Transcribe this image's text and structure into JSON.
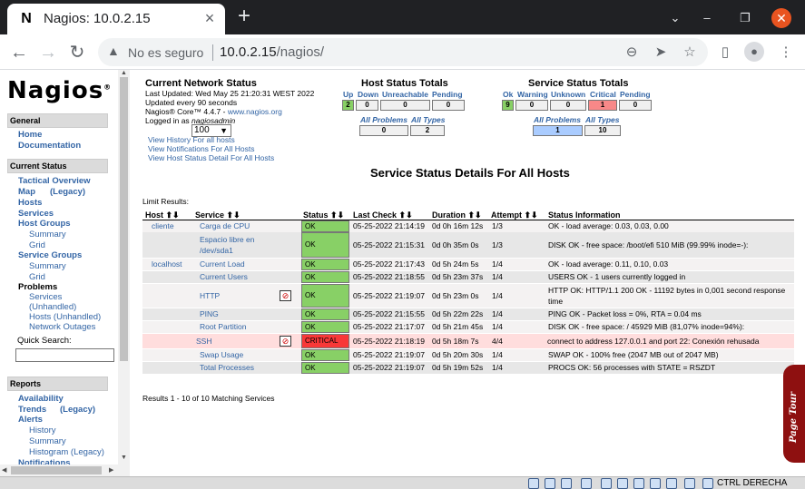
{
  "browser": {
    "tab_title": "Nagios: 10.0.2.15",
    "favicon": "N",
    "new_tab": "+",
    "not_secure": "No es seguro",
    "url_host": "10.0.2.15",
    "url_path": "/nagios/"
  },
  "sidebar": {
    "logo": "Nagios",
    "sections": {
      "general": "General",
      "current_status": "Current Status",
      "reports": "Reports"
    },
    "general_links": [
      "Home",
      "Documentation"
    ],
    "status_links": {
      "tactical": "Tactical Overview",
      "map": "Map",
      "legacy": "(Legacy)",
      "hosts": "Hosts",
      "services": "Services",
      "host_groups": "Host Groups",
      "hg_summary": "Summary",
      "hg_grid": "Grid",
      "service_groups": "Service Groups",
      "sg_summary": "Summary",
      "sg_grid": "Grid",
      "problems": "Problems",
      "p_services": "Services",
      "p_unhandled_1": "(Unhandled)",
      "p_hosts": "Hosts (Unhandled)",
      "p_network": "Network Outages"
    },
    "quick_search": "Quick Search:",
    "report_links": {
      "availability": "Availability",
      "trends": "Trends",
      "trends_legacy": "(Legacy)",
      "alerts": "Alerts",
      "history": "History",
      "summary": "Summary",
      "histogram": "Histogram (Legacy)",
      "notifications": "Notifications"
    }
  },
  "network_status": {
    "title": "Current Network Status",
    "last_updated": "Last Updated: Wed May 25 21:20:31 WEST 2022",
    "updated_every": "Updated every 90 seconds",
    "version_prefix": "Nagios® Core™ 4.4.7 - ",
    "version_link": "www.nagios.org",
    "logged_in_prefix": "Logged in as ",
    "logged_in_user": "nagiosadmin",
    "links": [
      "View History For all hosts",
      "View Notifications For All Hosts",
      "View Host Status Detail For All Hosts"
    ]
  },
  "host_totals": {
    "title": "Host Status Totals",
    "headers": [
      "Up",
      "Down",
      "Unreachable",
      "Pending"
    ],
    "values": [
      "2",
      "0",
      "0",
      "0"
    ],
    "all_headers": [
      "All Problems",
      "All Types"
    ],
    "all_values": [
      "0",
      "2"
    ]
  },
  "service_totals": {
    "title": "Service Status Totals",
    "headers": [
      "Ok",
      "Warning",
      "Unknown",
      "Critical",
      "Pending"
    ],
    "values": [
      "9",
      "0",
      "0",
      "1",
      "0"
    ],
    "all_headers": [
      "All Problems",
      "All Types"
    ],
    "all_values": [
      "1",
      "10"
    ]
  },
  "details": {
    "title": "Service Status Details For All Hosts",
    "limit_label": "Limit Results:",
    "limit_value": "100",
    "columns": [
      "Host",
      "Service",
      "Status",
      "Last Check",
      "Duration",
      "Attempt",
      "Status Information"
    ],
    "results": "Results 1 - 10 of 10 Matching Services",
    "rows": [
      {
        "host": "cliente",
        "service": "Carga de CPU",
        "status": "OK",
        "last": "05-25-2022 21:14:19",
        "duration": "0d 0h 16m 12s",
        "attempt": "1/3",
        "info": "OK - load average: 0.03, 0.03, 0.00"
      },
      {
        "host": "",
        "service": "Espacio libre en /dev/sda1",
        "status": "OK",
        "last": "05-25-2022 21:15:31",
        "duration": "0d 0h 35m 0s",
        "attempt": "1/3",
        "info": "DISK OK - free space: /boot/efi 510 MiB (99.99% inode=-):"
      },
      {
        "host": "localhost",
        "service": "Current Load",
        "status": "OK",
        "last": "05-25-2022 21:17:43",
        "duration": "0d 5h 24m 5s",
        "attempt": "1/4",
        "info": "OK - load average: 0.11, 0.10, 0.03"
      },
      {
        "host": "",
        "service": "Current Users",
        "status": "OK",
        "last": "05-25-2022 21:18:55",
        "duration": "0d 5h 23m 37s",
        "attempt": "1/4",
        "info": "USERS OK - 1 users currently logged in"
      },
      {
        "host": "",
        "service": "HTTP",
        "status": "OK",
        "last": "05-25-2022 21:19:07",
        "duration": "0d 5h 23m 0s",
        "attempt": "1/4",
        "info": "HTTP OK: HTTP/1.1 200 OK - 11192 bytes in 0,001 second response time"
      },
      {
        "host": "",
        "service": "PING",
        "status": "OK",
        "last": "05-25-2022 21:15:55",
        "duration": "0d 5h 22m 22s",
        "attempt": "1/4",
        "info": "PING OK - Packet loss = 0%, RTA = 0.04 ms"
      },
      {
        "host": "",
        "service": "Root Partition",
        "status": "OK",
        "last": "05-25-2022 21:17:07",
        "duration": "0d 5h 21m 45s",
        "attempt": "1/4",
        "info": "DISK OK - free space: / 45929 MiB (81,07% inode=94%):"
      },
      {
        "host": "",
        "service": "SSH",
        "status": "CRITICAL",
        "last": "05-25-2022 21:18:19",
        "duration": "0d 5h 18m 7s",
        "attempt": "4/4",
        "info": "connect to address 127.0.0.1 and port 22: Conexión rehusada"
      },
      {
        "host": "",
        "service": "Swap Usage",
        "status": "OK",
        "last": "05-25-2022 21:19:07",
        "duration": "0d 5h 20m 30s",
        "attempt": "1/4",
        "info": "SWAP OK - 100% free (2047 MB out of 2047 MB)"
      },
      {
        "host": "",
        "service": "Total Processes",
        "status": "OK",
        "last": "05-25-2022 21:19:07",
        "duration": "0d 5h 19m 52s",
        "attempt": "1/4",
        "info": "PROCS OK: 56 processes with STATE = RSZDT"
      }
    ]
  },
  "page_tour": "Page Tour",
  "vm_statusbar": {
    "hostkey": "CTRL DERECHA"
  },
  "colors": {
    "ok": "#88d066",
    "critical": "#f83838",
    "critical_row": "#ffdddd",
    "link": "#3365a5"
  }
}
